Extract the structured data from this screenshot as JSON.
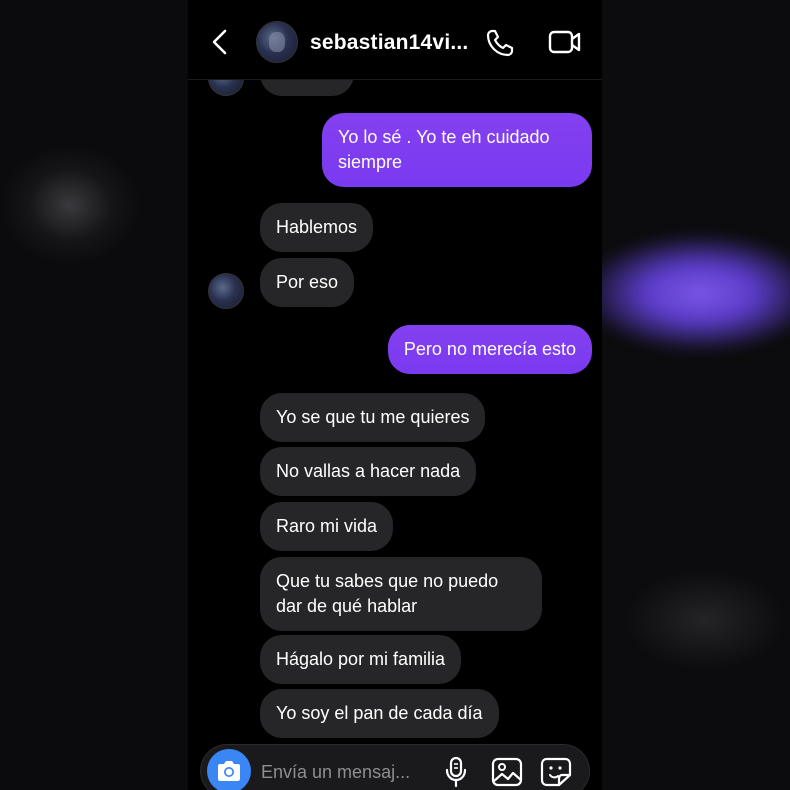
{
  "header": {
    "username": "sebastian14vi...",
    "icons": [
      "back-chevron-icon",
      "phone-icon",
      "video-camera-icon"
    ]
  },
  "messages": [
    {
      "from": "me",
      "text": "Yo lo sé . Yo te eh cuidado siempre"
    },
    {
      "from": "them",
      "text": "Hablemos"
    },
    {
      "from": "them",
      "text": "Por eso"
    },
    {
      "from": "me",
      "text": "Pero no merecía esto"
    },
    {
      "from": "them",
      "text": "Yo se que tu me quieres"
    },
    {
      "from": "them",
      "text": "No vallas a hacer nada"
    },
    {
      "from": "them",
      "text": "Raro mi vida"
    },
    {
      "from": "them",
      "text": "Que tu sabes que no puedo dar de qué hablar"
    },
    {
      "from": "them",
      "text": "Hágalo por mi familia"
    },
    {
      "from": "them",
      "text": "Yo soy el pan de cada día"
    }
  ],
  "composer": {
    "placeholder": "Envía un mensaj...",
    "icons": [
      "camera-icon",
      "microphone-icon",
      "gallery-icon",
      "sticker-icon"
    ]
  },
  "colors": {
    "outgoing_bubble": "#7c3df5",
    "incoming_bubble": "#262628",
    "camera_button": "#3b86f5",
    "background": "#000000"
  }
}
